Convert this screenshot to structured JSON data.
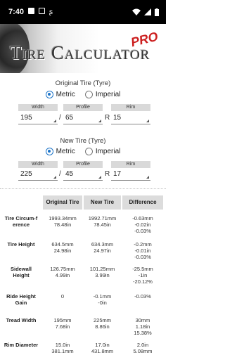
{
  "status_bar": {
    "time": "7:40"
  },
  "header": {
    "title": "Tire Calculator",
    "badge": "PRO"
  },
  "original": {
    "title": "Original Tire (Tyre)",
    "units": [
      {
        "label": "Metric",
        "selected": true
      },
      {
        "label": "Imperial",
        "selected": false
      }
    ],
    "headers": [
      "Width",
      "Profile",
      "Rim"
    ],
    "values": [
      "195",
      "65",
      "15"
    ],
    "separators": [
      "/",
      "R"
    ]
  },
  "new": {
    "title": "New Tire (Tyre)",
    "units": [
      {
        "label": "Metric",
        "selected": true
      },
      {
        "label": "Imperial",
        "selected": false
      }
    ],
    "headers": [
      "Width",
      "Profile",
      "Rim"
    ],
    "values": [
      "225",
      "45",
      "17"
    ],
    "separators": [
      "/",
      "R"
    ]
  },
  "results": {
    "columns": [
      "Original Tire",
      "New Tire",
      "Difference"
    ],
    "rows": [
      {
        "label": "Tire Circum-f erence",
        "original": "1993.34mm\n78.48in",
        "new": "1992.71mm\n78.45in",
        "difference": "-0.63mm\n-0.02in\n-0.03%"
      },
      {
        "label": "Tire Height",
        "original": "634.5mm\n24.98in",
        "new": "634.3mm\n24.97in",
        "difference": "-0.2mm\n-0.01in\n-0.03%"
      },
      {
        "label": "Sidewall Height",
        "original": "126.75mm\n4.99in",
        "new": "101.25mm\n3.99in",
        "difference": "-25.5mm\n-1in\n-20.12%"
      },
      {
        "label": "Ride Height Gain",
        "original": "0",
        "new": "-0.1mm\n-0in",
        "difference": "-0.03%"
      },
      {
        "label": "Tread Width",
        "original": "195mm\n7.68in",
        "new": "225mm\n8.86in",
        "difference": "30mm\n1.18in\n15.38%"
      },
      {
        "label": "Rim Diameter",
        "original": "15.0in\n381.1mm",
        "new": "17.0in\n431.8mm",
        "difference": "2.0in\n5.08mm"
      }
    ]
  }
}
